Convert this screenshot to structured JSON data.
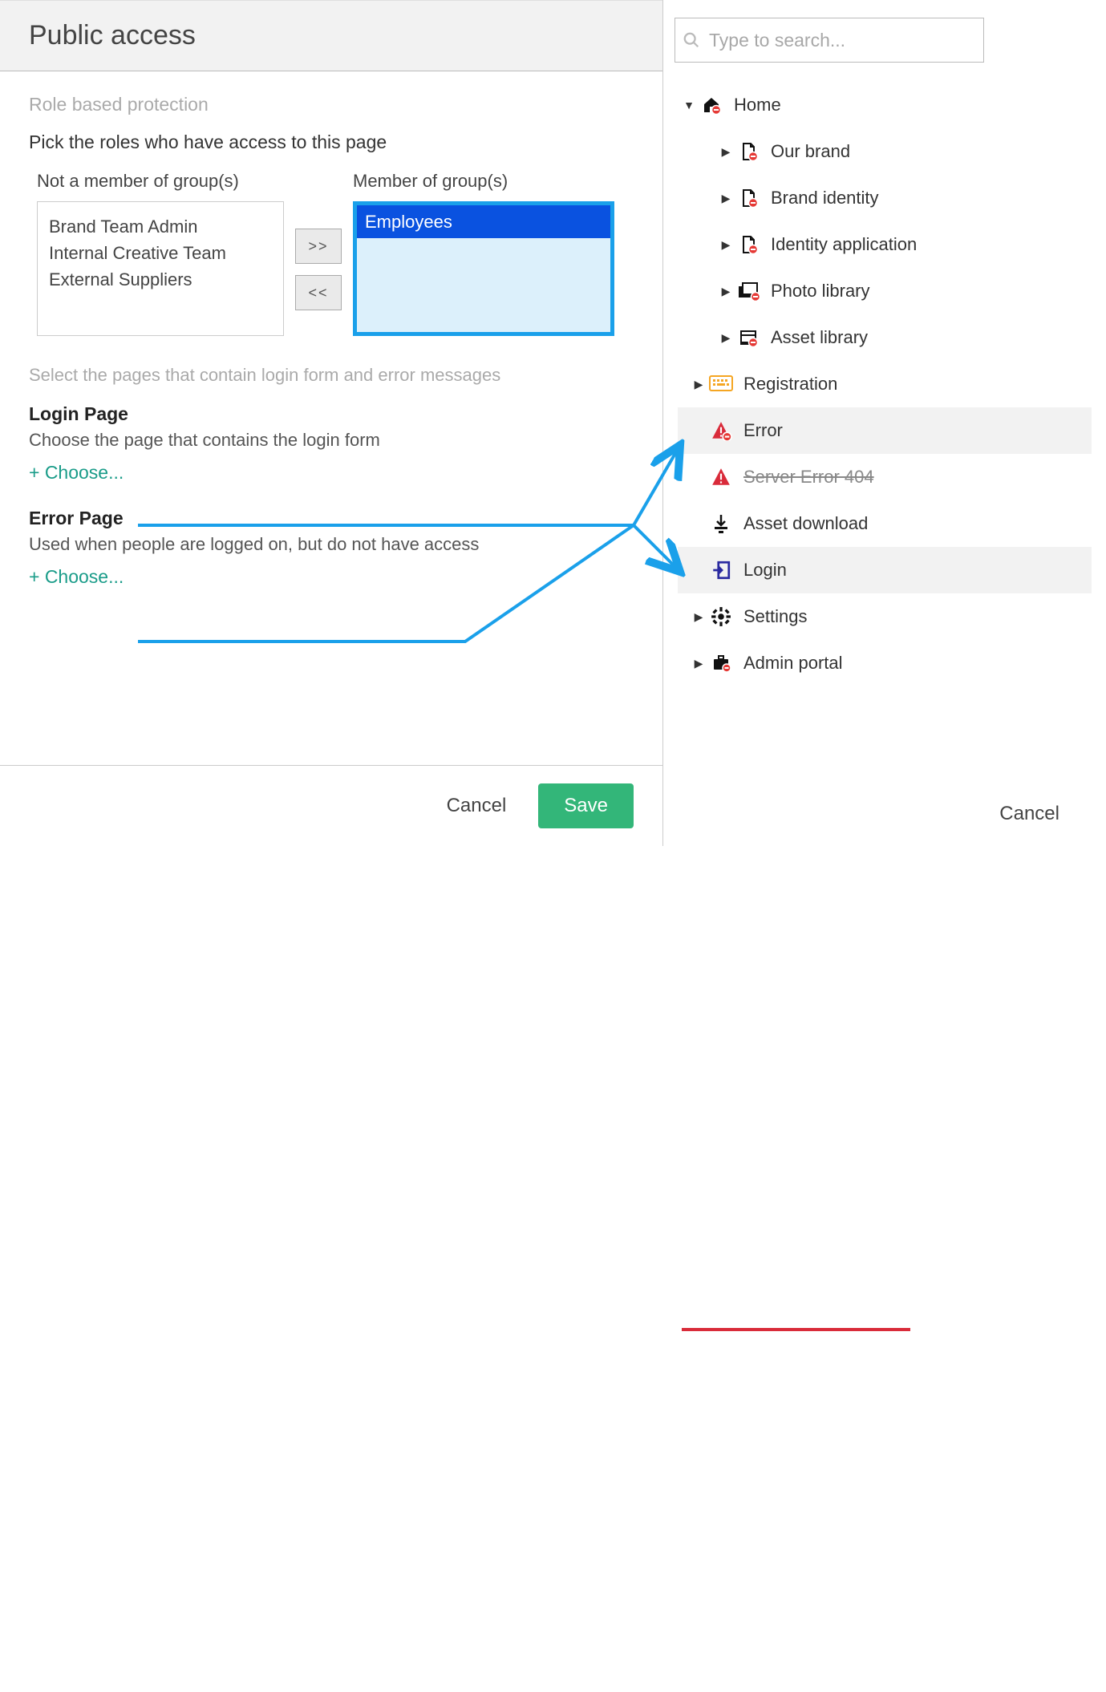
{
  "colors": {
    "accent_blue": "#1aa0ea",
    "accent_green": "#1a9c89",
    "save_green": "#33b679",
    "error_red": "#d92b3a",
    "keyboard_orange": "#f5a623"
  },
  "left": {
    "title": "Public access",
    "role_protection_heading": "Role based protection",
    "role_instruction": "Pick the roles who have access to this page",
    "not_member_label": "Not a member of group(s)",
    "member_label": "Member of group(s)",
    "not_member_items": [
      "Brand Team Admin",
      "Internal Creative Team",
      "External Suppliers"
    ],
    "member_items": [
      "Employees"
    ],
    "move_right_label": ">>",
    "move_left_label": "<<",
    "pages_heading": "Select the pages that contain login form and error messages",
    "login_page": {
      "title": "Login Page",
      "desc": "Choose the page that contains the login form",
      "choose_label": "+ Choose..."
    },
    "error_page": {
      "title": "Error Page",
      "desc": "Used when people are logged on, but do not have access",
      "choose_label": "+ Choose..."
    },
    "cancel_label": "Cancel",
    "save_label": "Save"
  },
  "right": {
    "search_placeholder": "Type to search...",
    "tree": [
      {
        "label": "Home",
        "icon": "home",
        "level": 0,
        "caret": "down",
        "badge": true
      },
      {
        "label": "Our brand",
        "icon": "page",
        "level": 1,
        "caret": "right",
        "badge": true
      },
      {
        "label": "Brand identity",
        "icon": "page",
        "level": 1,
        "caret": "right",
        "badge": true
      },
      {
        "label": "Identity application",
        "icon": "page",
        "level": 1,
        "caret": "right",
        "badge": true
      },
      {
        "label": "Photo library",
        "icon": "photos",
        "level": 1,
        "caret": "right",
        "badge": true
      },
      {
        "label": "Asset library",
        "icon": "library",
        "level": 1,
        "caret": "right",
        "badge": true
      },
      {
        "label": "Registration",
        "icon": "keyboard",
        "level": 0,
        "caret": "right",
        "indent": "b"
      },
      {
        "label": "Error",
        "icon": "warning",
        "level": 0,
        "highlight": true,
        "indent": "b",
        "badge": true
      },
      {
        "label": "Server Error 404",
        "icon": "warning",
        "level": 0,
        "strike": true,
        "indent": "b"
      },
      {
        "label": "Asset download",
        "icon": "download",
        "level": 0,
        "indent": "b"
      },
      {
        "label": "Login",
        "icon": "login",
        "level": 0,
        "highlight": true,
        "indent": "b"
      },
      {
        "label": "Settings",
        "icon": "gear",
        "level": 0,
        "caret": "right",
        "indent": "b"
      },
      {
        "label": "Admin portal",
        "icon": "briefcase",
        "level": 0,
        "caret": "right",
        "indent": "b",
        "badge": true
      }
    ],
    "cancel_label": "Cancel"
  }
}
